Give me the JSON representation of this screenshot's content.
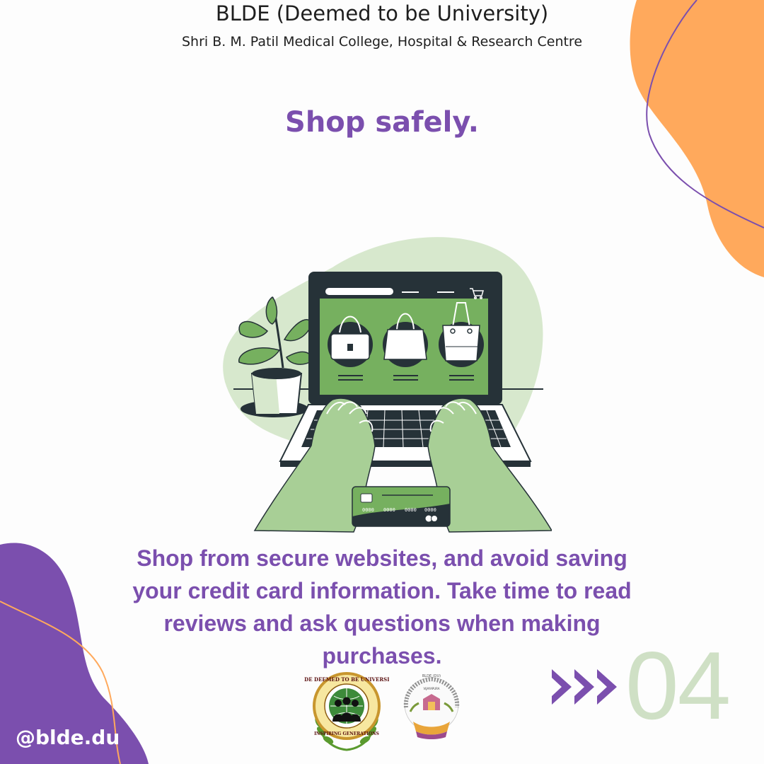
{
  "header": {
    "title": "BLDE (Deemed to be University)",
    "subtitle": "Shri B. M. Patil Medical College, Hospital & Research Centre"
  },
  "headline": "Shop safely.",
  "body_text": "Shop from secure websites, and avoid saving your credit card information. Take time to read reviews and ask questions when making purchases.",
  "slide_number": "04",
  "social_handle": "@blde.du",
  "illustration": {
    "card_number_groups": [
      "0000",
      "0000",
      "0000",
      "0000"
    ]
  },
  "logos": {
    "university_seal": {
      "ring_text": "BLDE DEEMED TO BE UNIVERSITY",
      "motto": "INSPIRING GENERATIONS"
    },
    "college_emblem": {
      "ring_text": "SHRI B. M. PATIL MEDICAL COLLEGE, HOSPITAL & RESEARCH CENTRE",
      "top_text": "BLDE (DU)",
      "city": "VIJAYAPURA"
    }
  },
  "colors": {
    "purple": "#7b4fae",
    "orange": "#ffa95c",
    "green": "#76b05f",
    "light_green": "#d7e8cd",
    "dark": "#263238"
  }
}
